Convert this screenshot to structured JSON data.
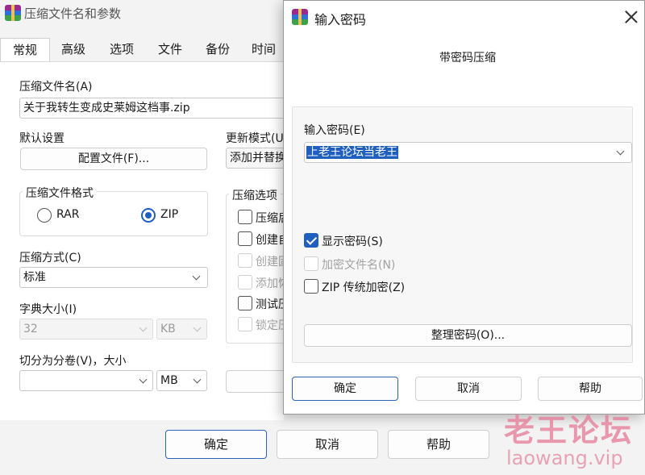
{
  "main_window": {
    "title": "压缩文件名和参数",
    "tabs": [
      "常规",
      "高级",
      "选项",
      "文件",
      "备份",
      "时间"
    ],
    "archive_name_label": "压缩文件名(A)",
    "archive_name_value": "关于我转生变成史莱姆这档事.zip",
    "default_settings_label": "默认设置",
    "profiles_button": "配置文件(F)...",
    "update_mode_label": "更新模式(U",
    "update_mode_value": "添加并替换",
    "format_group_title": "压缩文件格式",
    "format_rar": "RAR",
    "format_zip": "ZIP",
    "options_group_title": "压缩选项",
    "options": [
      {
        "label": "压缩后",
        "checked": false,
        "disabled": false
      },
      {
        "label": "创建自",
        "checked": false,
        "disabled": false
      },
      {
        "label": "创建固",
        "checked": false,
        "disabled": true
      },
      {
        "label": "添加恢",
        "checked": false,
        "disabled": true
      },
      {
        "label": "测试压",
        "checked": false,
        "disabled": false
      },
      {
        "label": "锁定压",
        "checked": false,
        "disabled": true
      }
    ],
    "method_label": "压缩方式(C)",
    "method_value": "标准",
    "dict_label": "字典大小(I)",
    "dict_value": "32",
    "dict_unit": "KB",
    "split_label": "切分为分卷(V)，大小",
    "split_value": "",
    "split_unit": "MB",
    "ok_button": "确定",
    "cancel_button": "取消",
    "help_button": "帮助"
  },
  "dialog": {
    "title": "输入密码",
    "subtitle": "带密码压缩",
    "password_label": "输入密码(E)",
    "password_value": "上老王论坛当老王",
    "show_password": {
      "label": "显示密码(S)",
      "checked": true
    },
    "encrypt_names": {
      "label": "加密文件名(N)",
      "checked": false,
      "disabled": true
    },
    "zip_legacy": {
      "label": "ZIP 传统加密(Z)",
      "checked": false
    },
    "organize_button": "整理密码(O)...",
    "ok_button": "确定",
    "cancel_button": "取消",
    "help_button": "帮助"
  },
  "watermark": {
    "brand": "老王论坛",
    "domain": "laowang.vip"
  },
  "colors": {
    "accent": "#1e5fc0",
    "window_bg": "#f3f3f3",
    "watermark": "#e67896"
  }
}
